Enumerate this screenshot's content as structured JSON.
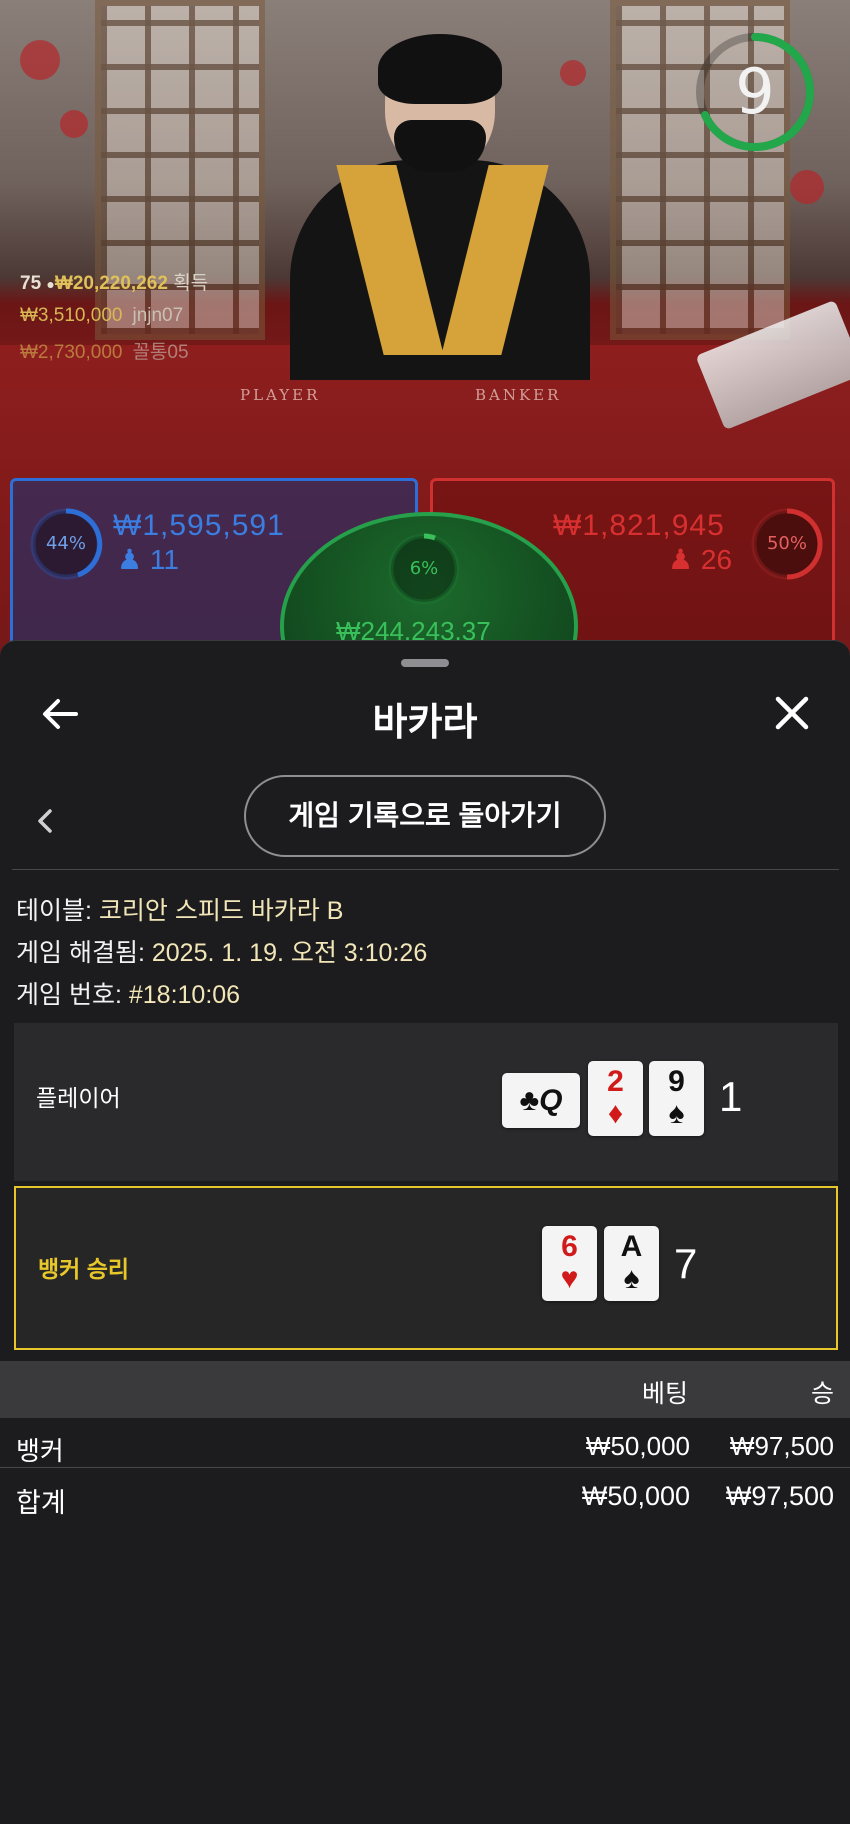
{
  "stream": {
    "timer": "9",
    "table_labels": {
      "player": "PLAYER",
      "banker": "BANKER"
    },
    "winners_top": {
      "count": "75",
      "amount": "₩20,220,262",
      "suffix": "획득"
    },
    "winners": [
      {
        "amount": "₩3,510,000",
        "name": "jnjn07"
      },
      {
        "amount": "₩2,730,000",
        "name": "꼴통05"
      }
    ],
    "player_bet": {
      "percent": "44%",
      "amount": "₩1,595,591",
      "players": "11",
      "color": "#2d6fd6"
    },
    "banker_bet": {
      "percent": "50%",
      "amount": "₩1,821,945",
      "players": "26",
      "color": "#d03030"
    },
    "tie_bet": {
      "percent": "6%",
      "amount": "₩244,243.37",
      "color": "#26a04a"
    }
  },
  "sheet": {
    "title": "바카라",
    "back_to_history": "게임 기록으로 돌아가기",
    "info": {
      "table_label": "테이블:",
      "table_value": "코리안 스피드 바카라 B",
      "resolved_label": "게임 해결됨:",
      "resolved_value": "2025. 1. 19. 오전 3:10:26",
      "number_label": "게임 번호:",
      "number_value": "#18:10:06"
    },
    "player_hand": {
      "label": "플레이어",
      "cards": [
        {
          "rank": "",
          "suit": "♣",
          "color": "black",
          "orientation": "side",
          "extra": "Q"
        },
        {
          "rank": "2",
          "suit": "♦",
          "color": "red"
        },
        {
          "rank": "9",
          "suit": "♠",
          "color": "black"
        }
      ],
      "score": "1"
    },
    "banker_hand": {
      "label": "뱅커 승리",
      "label_color": "#e8c72a",
      "cards": [
        {
          "rank": "6",
          "suit": "♥",
          "color": "red"
        },
        {
          "rank": "A",
          "suit": "♠",
          "color": "black"
        }
      ],
      "score": "7"
    },
    "bets_table": {
      "headers": {
        "bet": "베팅",
        "win": "승"
      },
      "rows": [
        {
          "name": "뱅커",
          "bet": "₩50,000",
          "win": "₩97,500"
        }
      ],
      "total": {
        "name": "합계",
        "bet": "₩50,000",
        "win": "₩97,500"
      }
    }
  }
}
